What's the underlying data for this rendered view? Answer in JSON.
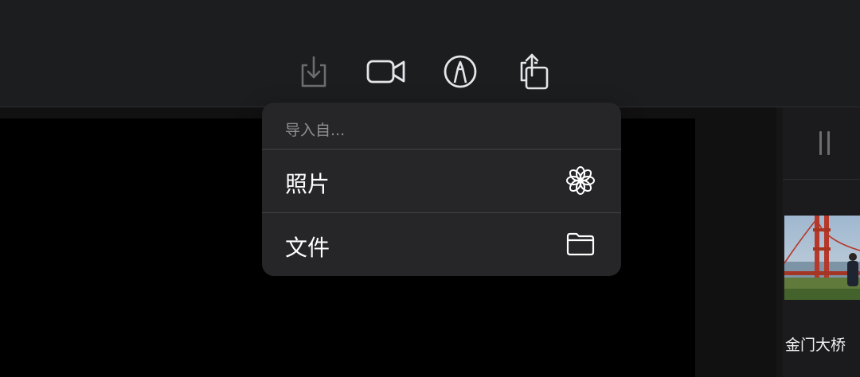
{
  "toolbar": {
    "buttons": [
      {
        "name": "import-button",
        "icon": "import-icon"
      },
      {
        "name": "camera-button",
        "icon": "video-camera-icon"
      },
      {
        "name": "markup-button",
        "icon": "markup-pen-icon"
      },
      {
        "name": "share-button",
        "icon": "share-icon"
      }
    ]
  },
  "popover": {
    "header": "导入自...",
    "items": [
      {
        "label": "照片",
        "icon": "photos-flower-icon"
      },
      {
        "label": "文件",
        "icon": "folder-icon"
      }
    ]
  },
  "side_panel": {
    "thumbnail_label": "金门大桥"
  },
  "colors": {
    "toolbar_bg": "#1c1d1f",
    "popover_bg": "#262628",
    "separator": "#444446",
    "header_text": "#8e8e93",
    "icon_dim": "#6d6d70",
    "icon_light": "#e5e5ea"
  }
}
